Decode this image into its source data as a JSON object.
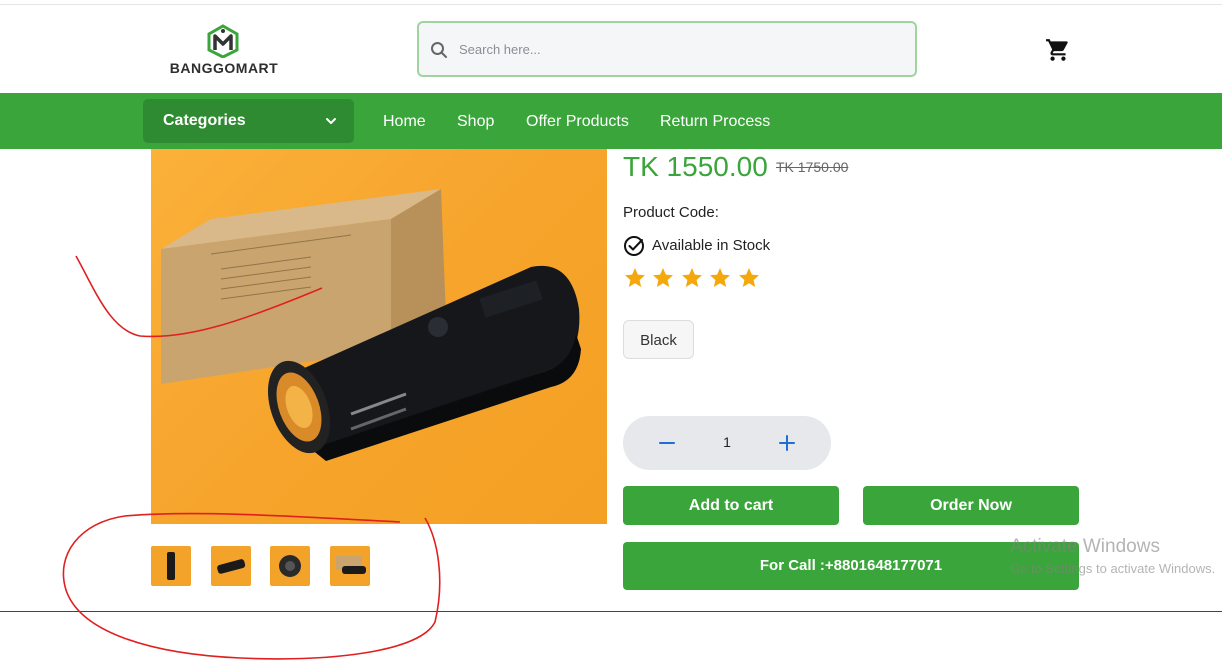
{
  "brand": {
    "logo_text": "BANGGOMART",
    "accent_color": "#3aa53a"
  },
  "search": {
    "placeholder": "Search here..."
  },
  "header": {
    "cart_icon": "cart-icon"
  },
  "nav": {
    "categories_label": "Categories",
    "links": [
      "Home",
      "Shop",
      "Offer Products",
      "Return Process"
    ]
  },
  "product": {
    "price": "TK 1550.00",
    "old_price": "TK 1750.00",
    "code_label": "Product Code:",
    "stock_text": "Available in Stock",
    "rating": 5,
    "variant": "Black",
    "quantity": "1",
    "images": {
      "thumbnail_count": 4
    }
  },
  "actions": {
    "add_to_cart": "Add to cart",
    "order_now": "Order Now",
    "call": "For Call :+8801648177071"
  },
  "watermark": {
    "title": "Activate Windows",
    "subtitle": "Go to Settings to activate Windows."
  },
  "annotation": {
    "stroke_color": "#e02020"
  }
}
